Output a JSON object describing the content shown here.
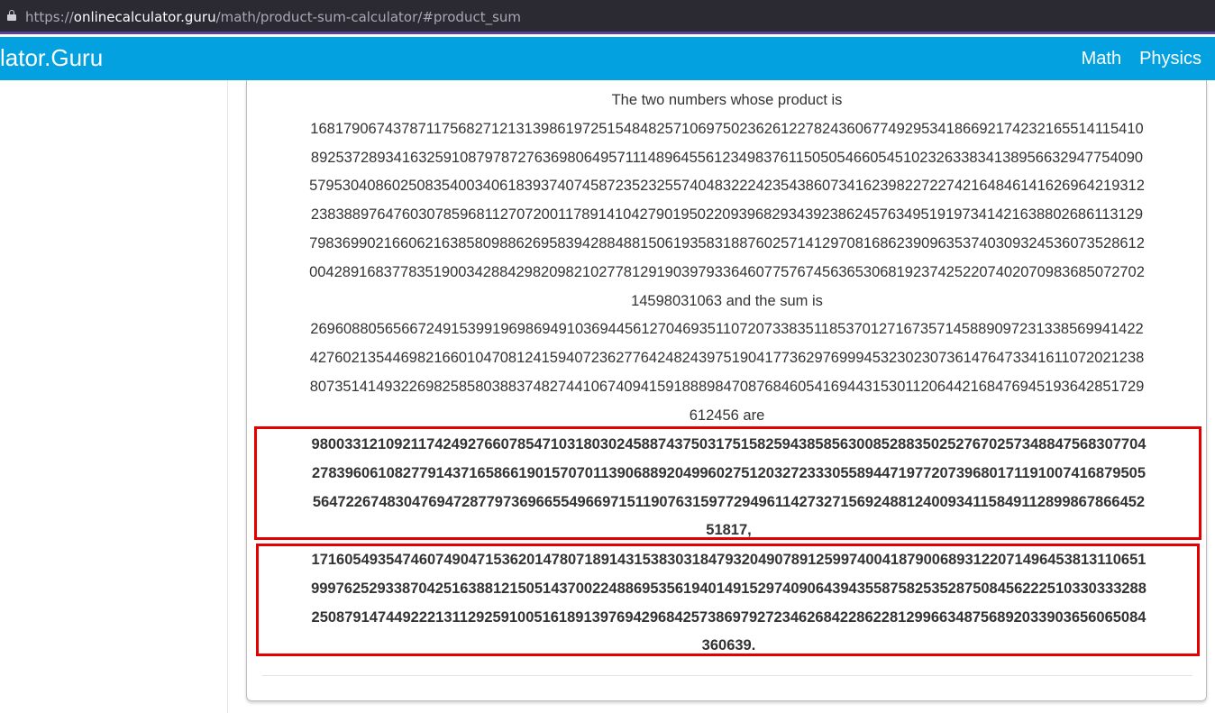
{
  "browser": {
    "url_scheme": "https://",
    "url_host": "onlinecalculator.guru",
    "url_path": "/math/product-sum-calculator/#product_sum"
  },
  "header": {
    "brand": "lator.Guru",
    "nav": [
      "Math",
      "Physics"
    ]
  },
  "result": {
    "intro": "The two numbers whose product is",
    "product_line1": "16817906743787117568271213139861972515484825710697502362612278243606774929534186692174232165514115410",
    "product_line2": "89253728934163259108797872763698064957111489645561234983761150505466054510232633834138956632947754090",
    "product_line3": "57953040860250835400340618393740745872352325574048322242354386073416239822722742164846141626964219312",
    "product_line4": "23838897647603078596811270720011789141042790195022093968293439238624576349519197341421638802686113129",
    "product_line5": "79836990216606216385809886269583942884881506193583188760257141297081686239096353740309324536073528612",
    "product_line6": "00428916837783519003428842982098210277812919039793364607757674563653068192374252207402070983685072702",
    "product_line7_and_sum_label": "14598031063 and the sum is",
    "sum_line1": "26960880565667249153991969869491036944561270469351107207338351185370127167357145889097231338569941422",
    "sum_line2": "42760213544698216601047081241594072362776424824397519041773629769994532302307361476473341611072021238",
    "sum_line3": "80735141493226982585803883748274410674094159188898470876846054169443153011206442168476945193642851729",
    "sum_line4_and_are": "612456 are",
    "number1_line1": "98003312109211742492766078547103180302458874375031751582594385856300852883502527670257348847568307704",
    "number1_line2": "27839606108277914371658661901570701139068892049960275120327233305589447197720739680171191007416879505",
    "number1_line3": "56472267483047694728779736966554966971511907631597729496114273271569248812400934115849112899867866452",
    "number1_line4": "51817,",
    "number2_line1": "17160549354746074904715362014780718914315383031847932049078912599740041879006893122071496453813110651",
    "number2_line2": "99976252933870425163881215051437002248869535619401491529740906439435587582535287508456222510330333288",
    "number2_line3": "25087914744922213112925910051618913976942968425738697927234626842286228129966348756892033903656065084",
    "number2_line4": "360639."
  },
  "colors": {
    "nav_bg": "#03a1e0",
    "highlight_border": "#e40000",
    "urlbar_bg": "#2b2a33"
  }
}
